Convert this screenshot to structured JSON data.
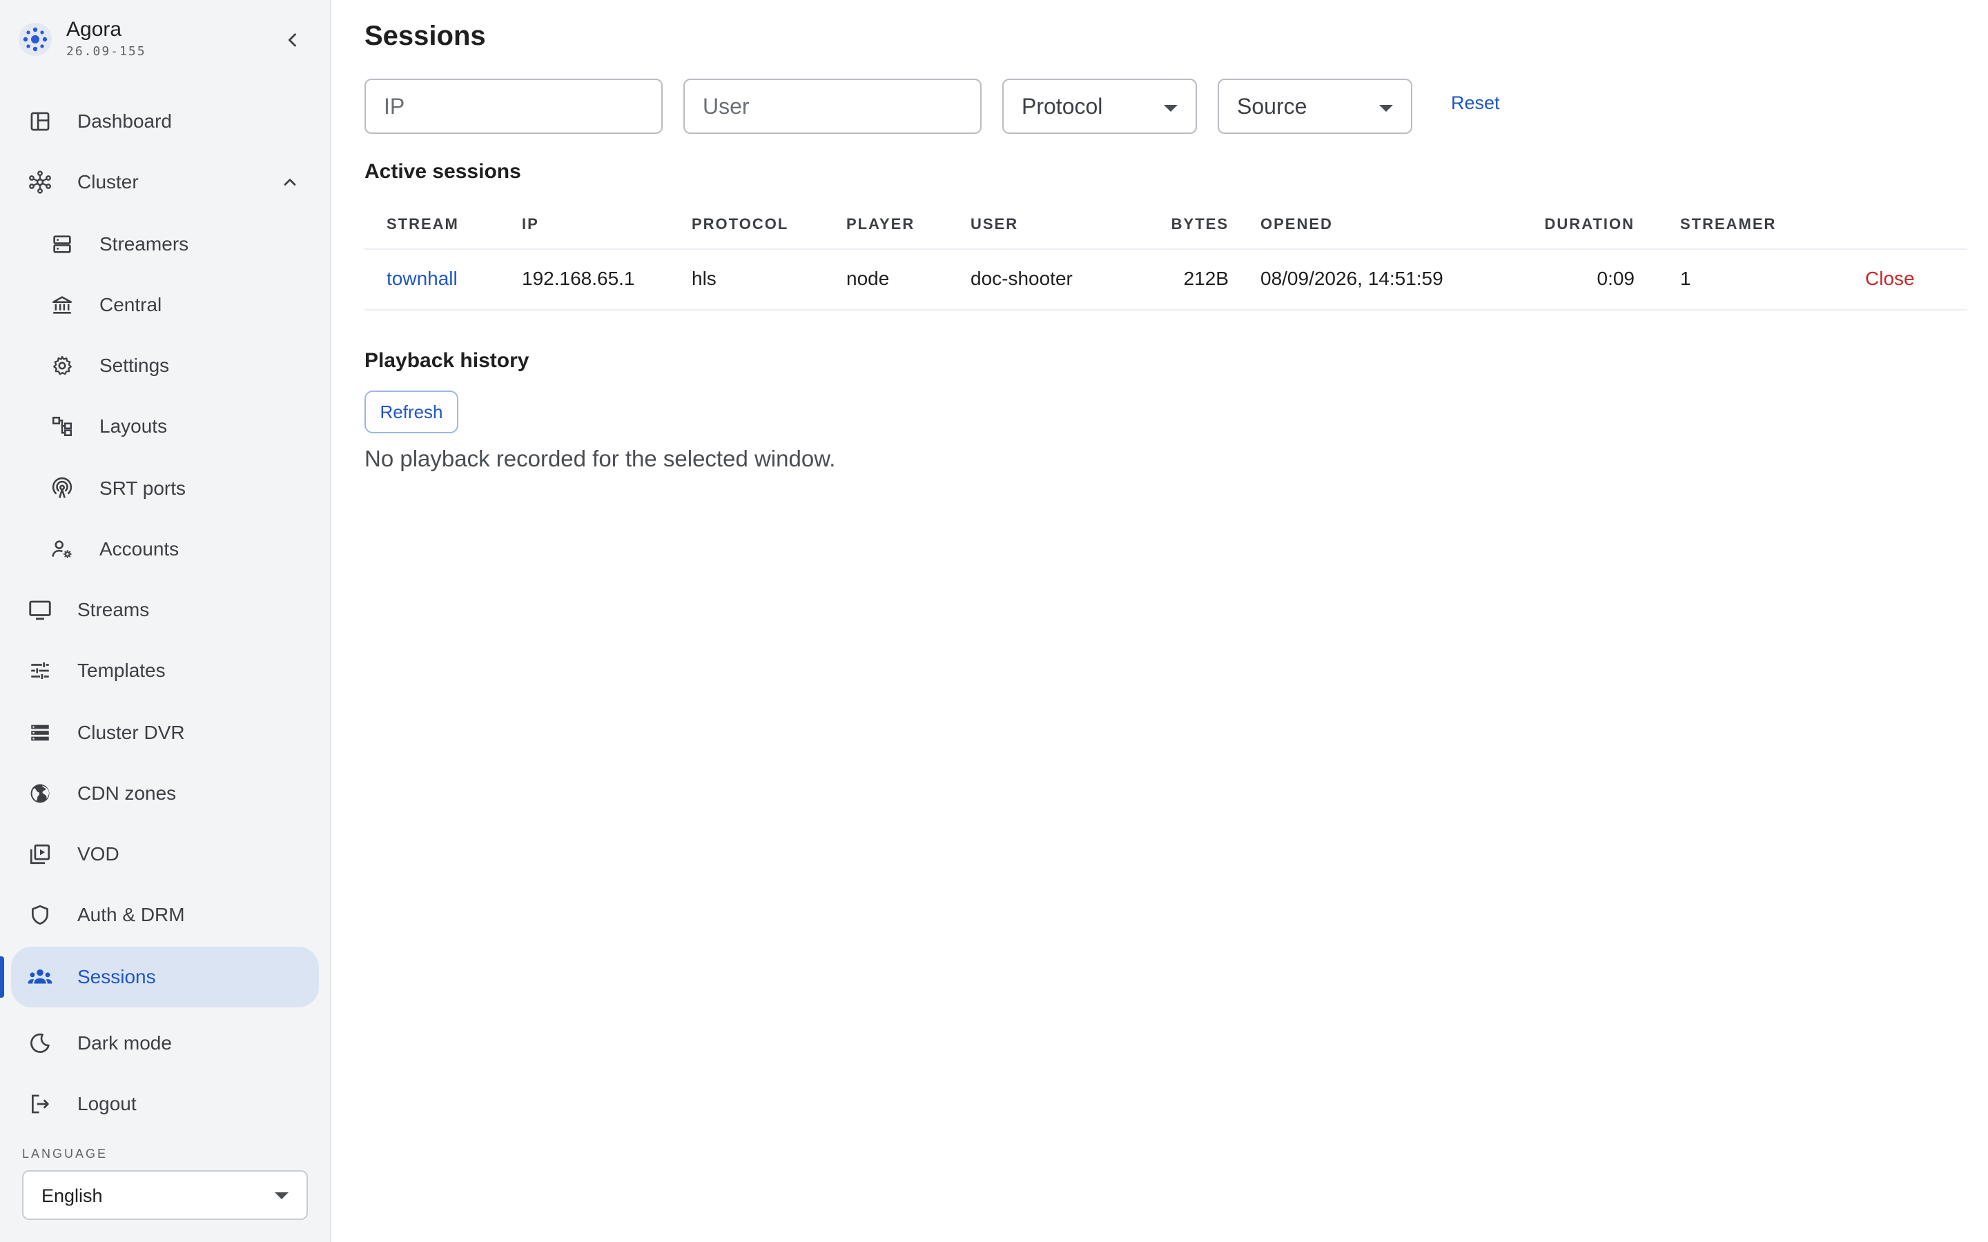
{
  "brand": {
    "name": "Agora",
    "version": "26.09-155"
  },
  "sidebar": {
    "items": [
      {
        "label": "Dashboard",
        "icon": "dashboard-icon"
      },
      {
        "label": "Cluster",
        "icon": "cluster-icon",
        "expanded": true
      },
      {
        "label": "Streamers",
        "icon": "streamers-icon"
      },
      {
        "label": "Central",
        "icon": "central-icon"
      },
      {
        "label": "Settings",
        "icon": "gear-icon"
      },
      {
        "label": "Layouts",
        "icon": "layouts-icon"
      },
      {
        "label": "SRT ports",
        "icon": "antenna-icon"
      },
      {
        "label": "Accounts",
        "icon": "user-gear-icon"
      },
      {
        "label": "Streams",
        "icon": "monitor-icon"
      },
      {
        "label": "Templates",
        "icon": "sliders-icon"
      },
      {
        "label": "Cluster DVR",
        "icon": "storage-icon"
      },
      {
        "label": "CDN zones",
        "icon": "globe-icon"
      },
      {
        "label": "VOD",
        "icon": "video-library-icon"
      },
      {
        "label": "Auth & DRM",
        "icon": "shield-icon"
      },
      {
        "label": "Sessions",
        "icon": "group-icon",
        "active": true
      },
      {
        "label": "Dark mode",
        "icon": "moon-icon"
      },
      {
        "label": "Logout",
        "icon": "logout-icon"
      }
    ],
    "language_label": "LANGUAGE",
    "language_value": "English"
  },
  "page": {
    "title": "Sessions"
  },
  "filters": {
    "ip_placeholder": "IP",
    "user_placeholder": "User",
    "protocol_value": "Protocol",
    "source_value": "Source",
    "reset_label": "Reset"
  },
  "active_sessions": {
    "title": "Active sessions",
    "columns": [
      "STREAM",
      "IP",
      "PROTOCOL",
      "PLAYER",
      "USER",
      "BYTES",
      "OPENED",
      "DURATION",
      "STREAMER"
    ],
    "rows": [
      {
        "stream": "townhall",
        "ip": "192.168.65.1",
        "protocol": "hls",
        "player": "node",
        "user": "doc-shooter",
        "bytes": "212B",
        "opened": "08/09/2026, 14:51:59",
        "duration": "0:09",
        "streamer": "1",
        "action": "Close"
      }
    ]
  },
  "playback_history": {
    "title": "Playback history",
    "refresh_label": "Refresh",
    "empty_message": "No playback recorded for the selected window."
  },
  "colors": {
    "accent": "#1f56c7",
    "active_bg": "#dbe4f3",
    "danger": "#c62828"
  }
}
